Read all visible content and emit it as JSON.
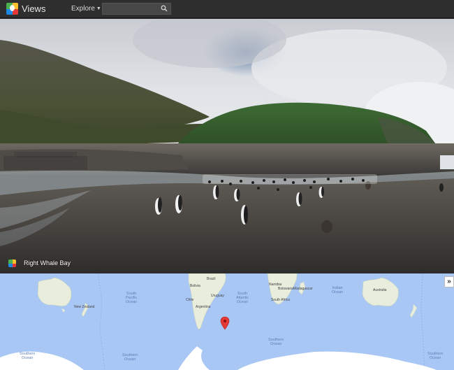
{
  "header": {
    "app_title": "Views",
    "explore_label": "Explore",
    "search": {
      "value": "",
      "placeholder": ""
    }
  },
  "panorama": {
    "caption": "Right Whale Bay"
  },
  "map": {
    "ocean_labels": [
      "South\nPacific\nOcean",
      "South\nAtlantic\nOcean",
      "Indian\nOcean",
      "Southern\nOcean",
      "Southern\nOcean",
      "Southern\nOcean",
      "Southern\nOcean"
    ],
    "land_labels": [
      "Brazil",
      "Bolivia",
      "Argentina",
      "Chile",
      "Uruguay",
      "Namibia",
      "Botswana",
      "South Africa",
      "Madagascar",
      "Australia",
      "New Zealand"
    ],
    "expand_label": "»",
    "colors": {
      "ocean": "#a9c7f5",
      "land": "#e8eddc",
      "marker": "#e53935"
    }
  }
}
